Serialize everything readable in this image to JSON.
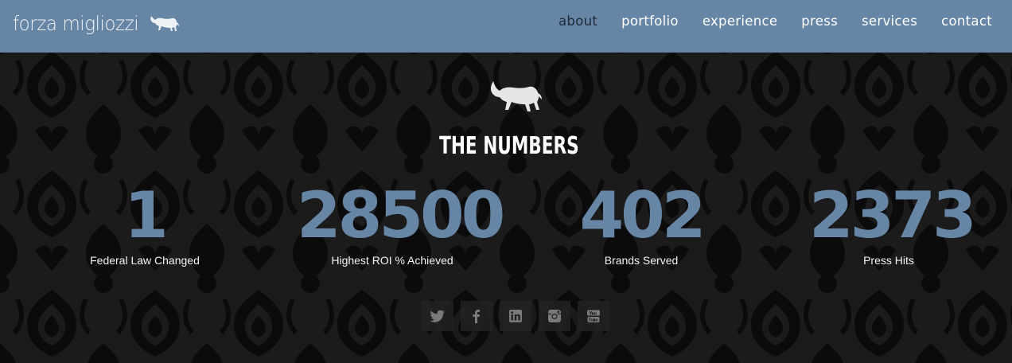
{
  "header": {
    "logo_text": "forza migliozzi",
    "nav": [
      {
        "label": "about",
        "active": true
      },
      {
        "label": "portfolio"
      },
      {
        "label": "experience"
      },
      {
        "label": "press"
      },
      {
        "label": "services"
      },
      {
        "label": "contact"
      }
    ]
  },
  "main": {
    "title": "THE NUMBERS",
    "stats": [
      {
        "value": "1",
        "label": "Federal Law Changed"
      },
      {
        "value": "28500",
        "label": "Highest ROI % Achieved"
      },
      {
        "value": "402",
        "label": "Brands Served"
      },
      {
        "value": "2373",
        "label": "Press Hits"
      }
    ],
    "social": [
      {
        "icon": "twitter-icon"
      },
      {
        "icon": "facebook-icon"
      },
      {
        "icon": "linkedin-icon"
      },
      {
        "icon": "instagram-icon"
      },
      {
        "icon": "youtube-icon"
      }
    ]
  },
  "colors": {
    "header_bg": "#6786a6",
    "accent": "#6786a6",
    "background": "#1e1e1e",
    "damask": "#0c0c0c"
  }
}
